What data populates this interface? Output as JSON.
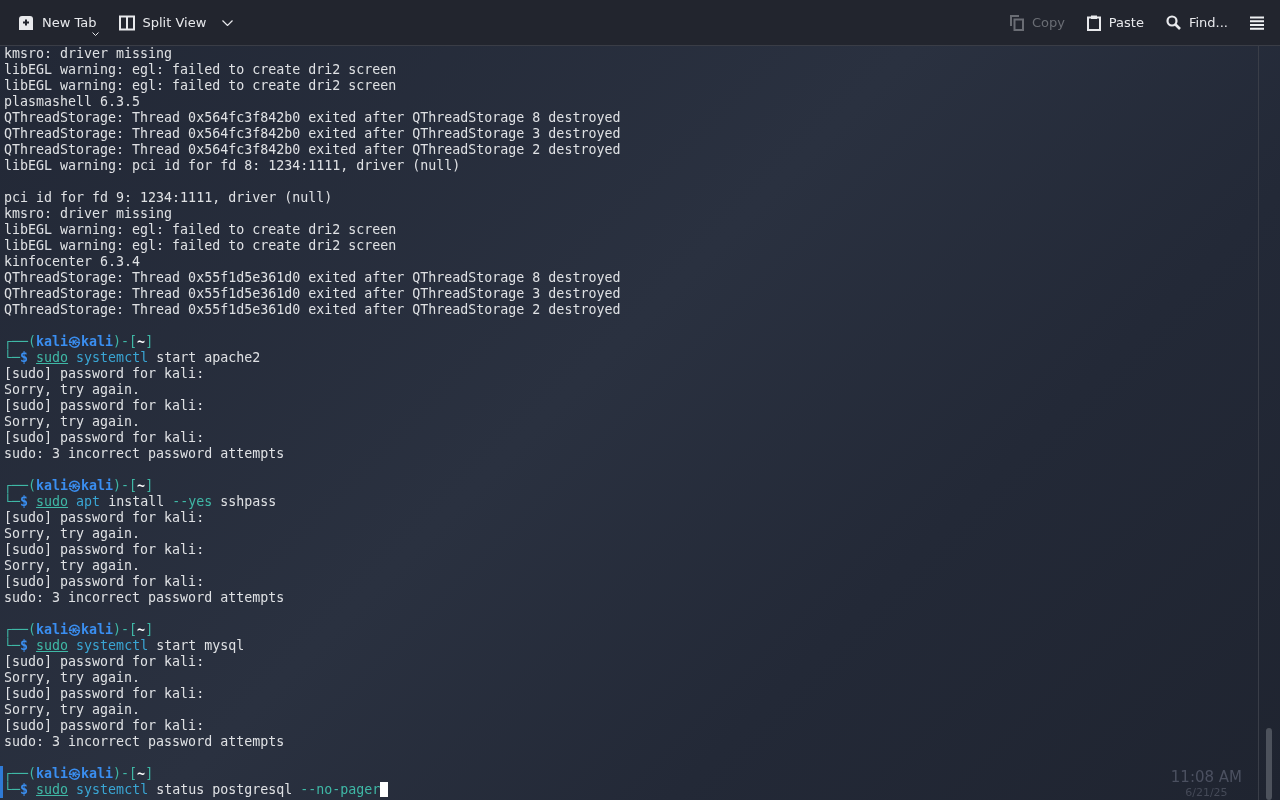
{
  "toolbar": {
    "left": [
      {
        "label": "New Tab",
        "kind": "new-tab",
        "disabled": false,
        "has_menu": true
      },
      {
        "label": "Split View",
        "kind": "split",
        "disabled": false,
        "has_menu": true
      }
    ],
    "right": [
      {
        "label": "Copy",
        "kind": "copy",
        "disabled": true
      },
      {
        "label": "Paste",
        "kind": "paste",
        "disabled": false
      },
      {
        "label": "Find...",
        "kind": "search",
        "disabled": false
      }
    ]
  },
  "terminal": {
    "lines": [
      {
        "kind": "plain",
        "text": "kmsro: driver missing"
      },
      {
        "kind": "plain",
        "text": "libEGL warning: egl: failed to create dri2 screen"
      },
      {
        "kind": "plain",
        "text": "libEGL warning: egl: failed to create dri2 screen"
      },
      {
        "kind": "plain",
        "text": "plasmashell 6.3.5"
      },
      {
        "kind": "plain",
        "text": "QThreadStorage: Thread 0x564fc3f842b0 exited after QThreadStorage 8 destroyed"
      },
      {
        "kind": "plain",
        "text": "QThreadStorage: Thread 0x564fc3f842b0 exited after QThreadStorage 3 destroyed"
      },
      {
        "kind": "plain",
        "text": "QThreadStorage: Thread 0x564fc3f842b0 exited after QThreadStorage 2 destroyed"
      },
      {
        "kind": "plain",
        "text": "libEGL warning: pci id for fd 8: 1234:1111, driver (null)"
      },
      {
        "kind": "blank"
      },
      {
        "kind": "plain",
        "text": "pci id for fd 9: 1234:1111, driver (null)"
      },
      {
        "kind": "plain",
        "text": "kmsro: driver missing"
      },
      {
        "kind": "plain",
        "text": "libEGL warning: egl: failed to create dri2 screen"
      },
      {
        "kind": "plain",
        "text": "libEGL warning: egl: failed to create dri2 screen"
      },
      {
        "kind": "plain",
        "text": "kinfocenter 6.3.4"
      },
      {
        "kind": "plain",
        "text": "QThreadStorage: Thread 0x55f1d5e361d0 exited after QThreadStorage 8 destroyed"
      },
      {
        "kind": "plain",
        "text": "QThreadStorage: Thread 0x55f1d5e361d0 exited after QThreadStorage 3 destroyed"
      },
      {
        "kind": "plain",
        "text": "QThreadStorage: Thread 0x55f1d5e361d0 exited after QThreadStorage 2 destroyed"
      },
      {
        "kind": "blank"
      },
      {
        "kind": "prompt",
        "corner": "┌──(",
        "user_host": "kali㉿kali",
        "mid": ")-[",
        "dir": "~",
        "end": "]"
      },
      {
        "kind": "command",
        "corner": "└─",
        "sign": "$",
        "tokens": [
          {
            "kind": "sudo",
            "text": "sudo"
          },
          {
            "kind": "program",
            "text": "systemctl"
          },
          {
            "kind": "arg",
            "text": "start"
          },
          {
            "kind": "arg",
            "text": "apache2"
          }
        ]
      },
      {
        "kind": "plain",
        "text": "[sudo] password for kali:"
      },
      {
        "kind": "plain",
        "text": "Sorry, try again."
      },
      {
        "kind": "plain",
        "text": "[sudo] password for kali:"
      },
      {
        "kind": "plain",
        "text": "Sorry, try again."
      },
      {
        "kind": "plain",
        "text": "[sudo] password for kali:"
      },
      {
        "kind": "plain",
        "text": "sudo: 3 incorrect password attempts"
      },
      {
        "kind": "blank"
      },
      {
        "kind": "prompt",
        "corner": "┌──(",
        "user_host": "kali㉿kali",
        "mid": ")-[",
        "dir": "~",
        "end": "]"
      },
      {
        "kind": "command",
        "corner": "└─",
        "sign": "$",
        "tokens": [
          {
            "kind": "sudo",
            "text": "sudo"
          },
          {
            "kind": "program",
            "text": "apt"
          },
          {
            "kind": "arg",
            "text": "install"
          },
          {
            "kind": "option",
            "text": "--yes"
          },
          {
            "kind": "arg",
            "text": "sshpass"
          }
        ]
      },
      {
        "kind": "plain",
        "text": "[sudo] password for kali:"
      },
      {
        "kind": "plain",
        "text": "Sorry, try again."
      },
      {
        "kind": "plain",
        "text": "[sudo] password for kali:"
      },
      {
        "kind": "plain",
        "text": "Sorry, try again."
      },
      {
        "kind": "plain",
        "text": "[sudo] password for kali:"
      },
      {
        "kind": "plain",
        "text": "sudo: 3 incorrect password attempts"
      },
      {
        "kind": "blank"
      },
      {
        "kind": "prompt",
        "corner": "┌──(",
        "user_host": "kali㉿kali",
        "mid": ")-[",
        "dir": "~",
        "end": "]"
      },
      {
        "kind": "command",
        "corner": "└─",
        "sign": "$",
        "tokens": [
          {
            "kind": "sudo",
            "text": "sudo"
          },
          {
            "kind": "program",
            "text": "systemctl"
          },
          {
            "kind": "arg",
            "text": "start"
          },
          {
            "kind": "arg",
            "text": "mysql"
          }
        ]
      },
      {
        "kind": "plain",
        "text": "[sudo] password for kali:"
      },
      {
        "kind": "plain",
        "text": "Sorry, try again."
      },
      {
        "kind": "plain",
        "text": "[sudo] password for kali:"
      },
      {
        "kind": "plain",
        "text": "Sorry, try again."
      },
      {
        "kind": "plain",
        "text": "[sudo] password for kali:"
      },
      {
        "kind": "plain",
        "text": "sudo: 3 incorrect password attempts"
      },
      {
        "kind": "blank"
      },
      {
        "kind": "prompt",
        "corner": "┌──(",
        "user_host": "kali㉿kali",
        "mid": ")-[",
        "dir": "~",
        "end": "]",
        "current": true
      },
      {
        "kind": "command",
        "corner": "└─",
        "sign": "$",
        "current": true,
        "cursor": true,
        "tokens": [
          {
            "kind": "sudo",
            "text": "sudo"
          },
          {
            "kind": "program",
            "text": "systemctl"
          },
          {
            "kind": "arg",
            "text": "status"
          },
          {
            "kind": "arg",
            "text": "postgresql"
          },
          {
            "kind": "option",
            "text": "--no-pager"
          }
        ]
      }
    ]
  },
  "taskbar": {
    "time": "11:08 AM",
    "date": "6/21/25"
  }
}
